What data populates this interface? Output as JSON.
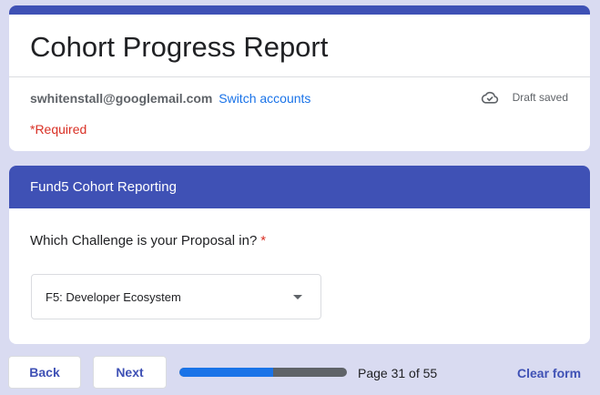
{
  "form": {
    "title": "Cohort Progress Report",
    "accent_color": "#3f51b5"
  },
  "account": {
    "email": "swhitenstall@googlemail.com",
    "switch_label": "Switch accounts",
    "draft_status": "Draft saved",
    "draft_icon": "cloud-check-icon"
  },
  "required_note": "*Required",
  "section": {
    "title": "Fund5 Cohort Reporting",
    "question": {
      "label": "Which Challenge is your Proposal in?",
      "required_mark": "*",
      "selected_value": "F5: Developer Ecosystem"
    }
  },
  "navigation": {
    "back_label": "Back",
    "next_label": "Next",
    "page_label": "Page 31 of 55",
    "current_page": 31,
    "total_pages": 55,
    "progress_fraction": 0.56,
    "clear_label": "Clear form"
  }
}
